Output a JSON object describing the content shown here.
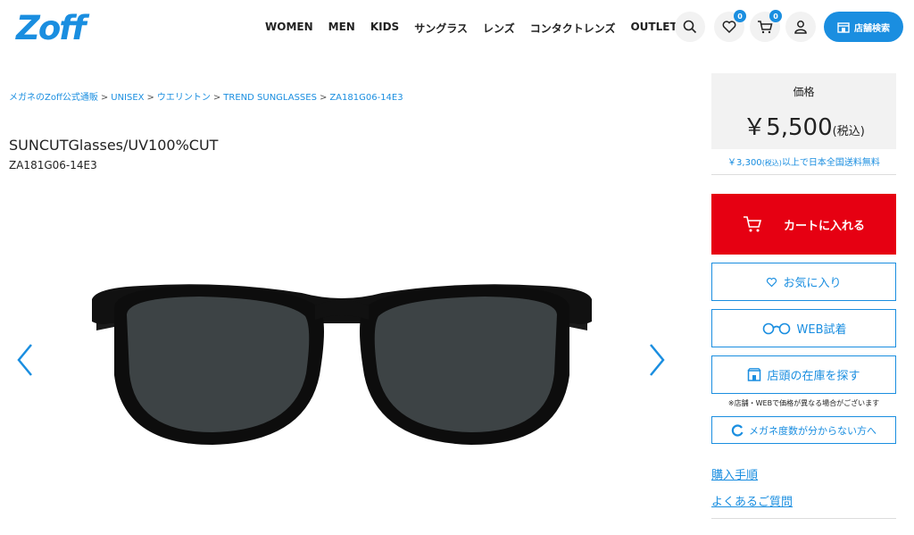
{
  "header": {
    "logo": "Zoff",
    "nav": [
      "WOMEN",
      "MEN",
      "KIDS",
      "サングラス",
      "レンズ",
      "コンタクトレンズ",
      "OUTLET"
    ],
    "fav_count": "0",
    "cart_count": "0",
    "store_search": "店舗検索",
    "accent": "#1a8ee0"
  },
  "breadcrumb": [
    "メガネのZoff公式通販",
    "UNISEX",
    "ウエリントン",
    "TREND SUNGLASSES",
    "ZA181G06-14E3"
  ],
  "product": {
    "title": "SUNCUTGlasses/UV100%CUT",
    "code": "ZA181G06-14E3"
  },
  "price": {
    "label": "価格",
    "value": "￥5,500",
    "tax": "(税込)",
    "shipping_amount": "￥3,300",
    "shipping_tax": "(税込)",
    "shipping_text": "以上で日本全国送料無料"
  },
  "actions": {
    "cart": "カートに入れる",
    "cart_color": "#e60012",
    "favorite": "お気に入り",
    "web_try": "WEB試着",
    "stock": "店頭の在庫を探す",
    "note": "※店舗・WEBで価格が異なる場合がございます",
    "degree": "メガネ度数が分からない方へ"
  },
  "links": {
    "purchase": "購入手順",
    "faq": "よくあるご質問"
  }
}
